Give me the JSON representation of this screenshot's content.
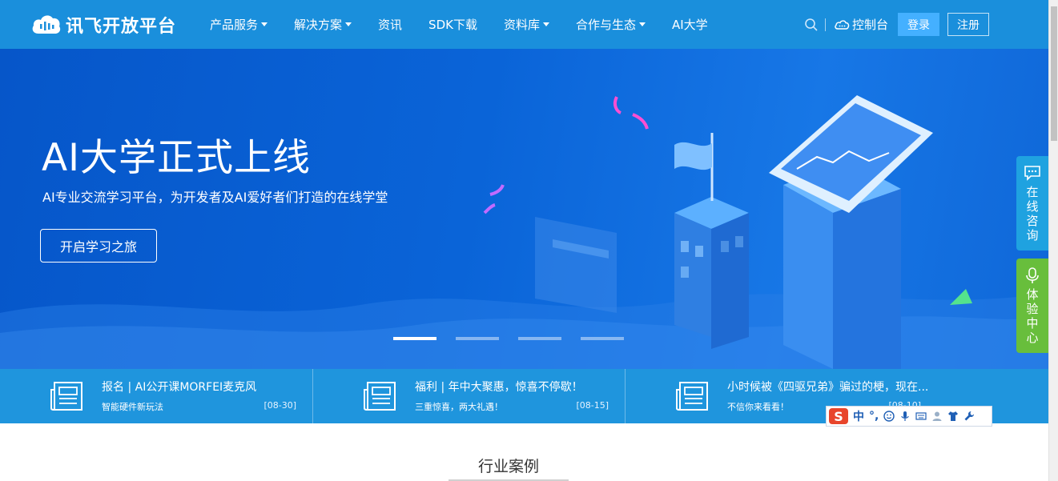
{
  "header": {
    "logo_text": "讯飞开放平台",
    "nav": [
      {
        "label": "产品服务",
        "has_dropdown": true
      },
      {
        "label": "解决方案",
        "has_dropdown": true
      },
      {
        "label": "资讯",
        "has_dropdown": false
      },
      {
        "label": "SDK下载",
        "has_dropdown": false
      },
      {
        "label": "资料库",
        "has_dropdown": true
      },
      {
        "label": "合作与生态",
        "has_dropdown": true
      },
      {
        "label": "AI大学",
        "has_dropdown": false
      }
    ],
    "console_label": "控制台",
    "login_label": "登录",
    "register_label": "注册"
  },
  "banner": {
    "title": "AI大学正式上线",
    "subtitle": "AI专业交流学习平台，为开发者及AI爱好者们打造的在线学堂",
    "cta_label": "开启学习之旅",
    "slide_count": 4,
    "active_slide": 1
  },
  "news": [
    {
      "title": "报名 | AI公开课MORFEI麦克风",
      "subtitle": "智能硬件新玩法",
      "date": "[08-30]"
    },
    {
      "title": "福利 | 年中大聚惠，惊喜不停歇！",
      "subtitle": "三重惊喜，两大礼遇！",
      "date": "[08-15]"
    },
    {
      "title": "小时候被《四驱兄弟》骗过的梗，现在...",
      "subtitle": "不信你来看看！",
      "date": "[08-10]"
    }
  ],
  "section": {
    "title": "行业案例"
  },
  "side": {
    "chat_label": "在线咨询",
    "experience_label": "体验中心"
  },
  "ime": {
    "logo": "S",
    "mode": "中",
    "punct": "°,"
  },
  "colors": {
    "header_bg": "#1a8fdc",
    "banner_bg": "#0a64d8",
    "news_bg": "#1f95dd",
    "login_bg": "#44b0ff",
    "chat_bg": "#1fa2e0",
    "experience_bg": "#68be3c"
  }
}
